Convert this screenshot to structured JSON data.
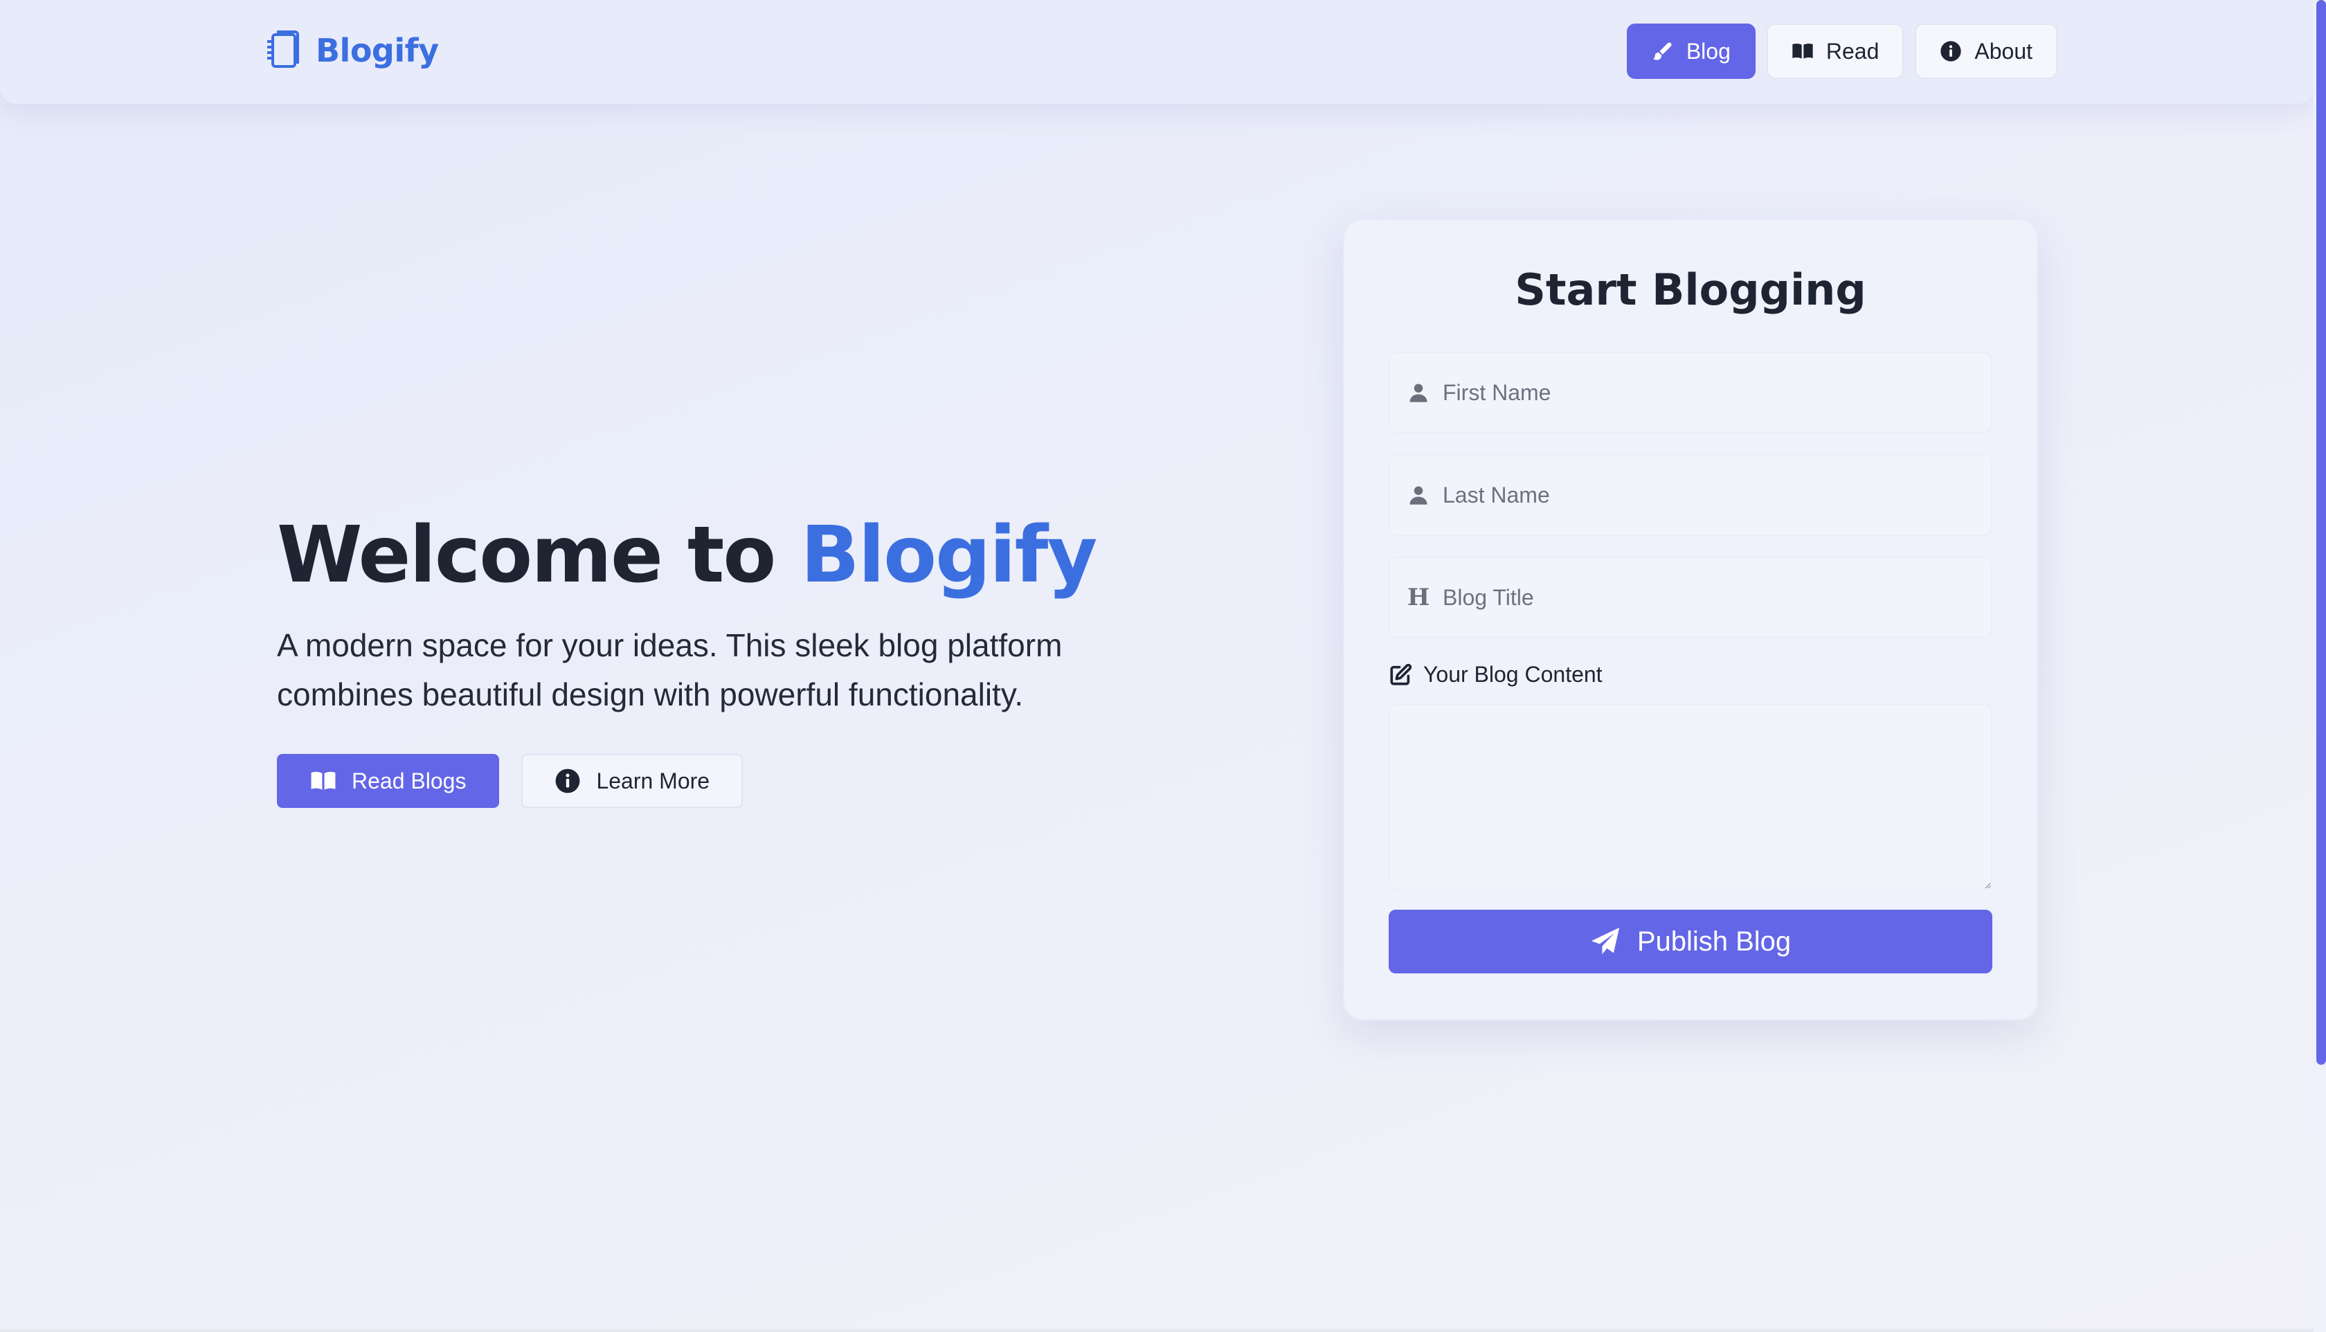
{
  "brand": {
    "name": "Blogify"
  },
  "nav": {
    "items": [
      {
        "label": "Blog",
        "icon": "pen-icon",
        "active": true
      },
      {
        "label": "Read",
        "icon": "book-open-icon",
        "active": false
      },
      {
        "label": "About",
        "icon": "info-circle-icon",
        "active": false
      }
    ]
  },
  "hero": {
    "title_prefix": "Welcome to ",
    "title_accent": "Blogify",
    "description": "A modern space for your ideas. This sleek blog platform combines beautiful design with powerful functionality.",
    "primary_button": "Read Blogs",
    "secondary_button": "Learn More"
  },
  "form": {
    "title": "Start Blogging",
    "first_name": {
      "placeholder": "First Name",
      "value": ""
    },
    "last_name": {
      "placeholder": "Last Name",
      "value": ""
    },
    "blog_title": {
      "placeholder": "Blog Title",
      "value": "",
      "icon_glyph": "H"
    },
    "content_label": "Your Blog Content",
    "content_value": "",
    "submit_label": "Publish Blog"
  },
  "colors": {
    "accent": "#6366e6",
    "brand_blue": "#3b6fe0",
    "text_dark": "#1f2433"
  }
}
